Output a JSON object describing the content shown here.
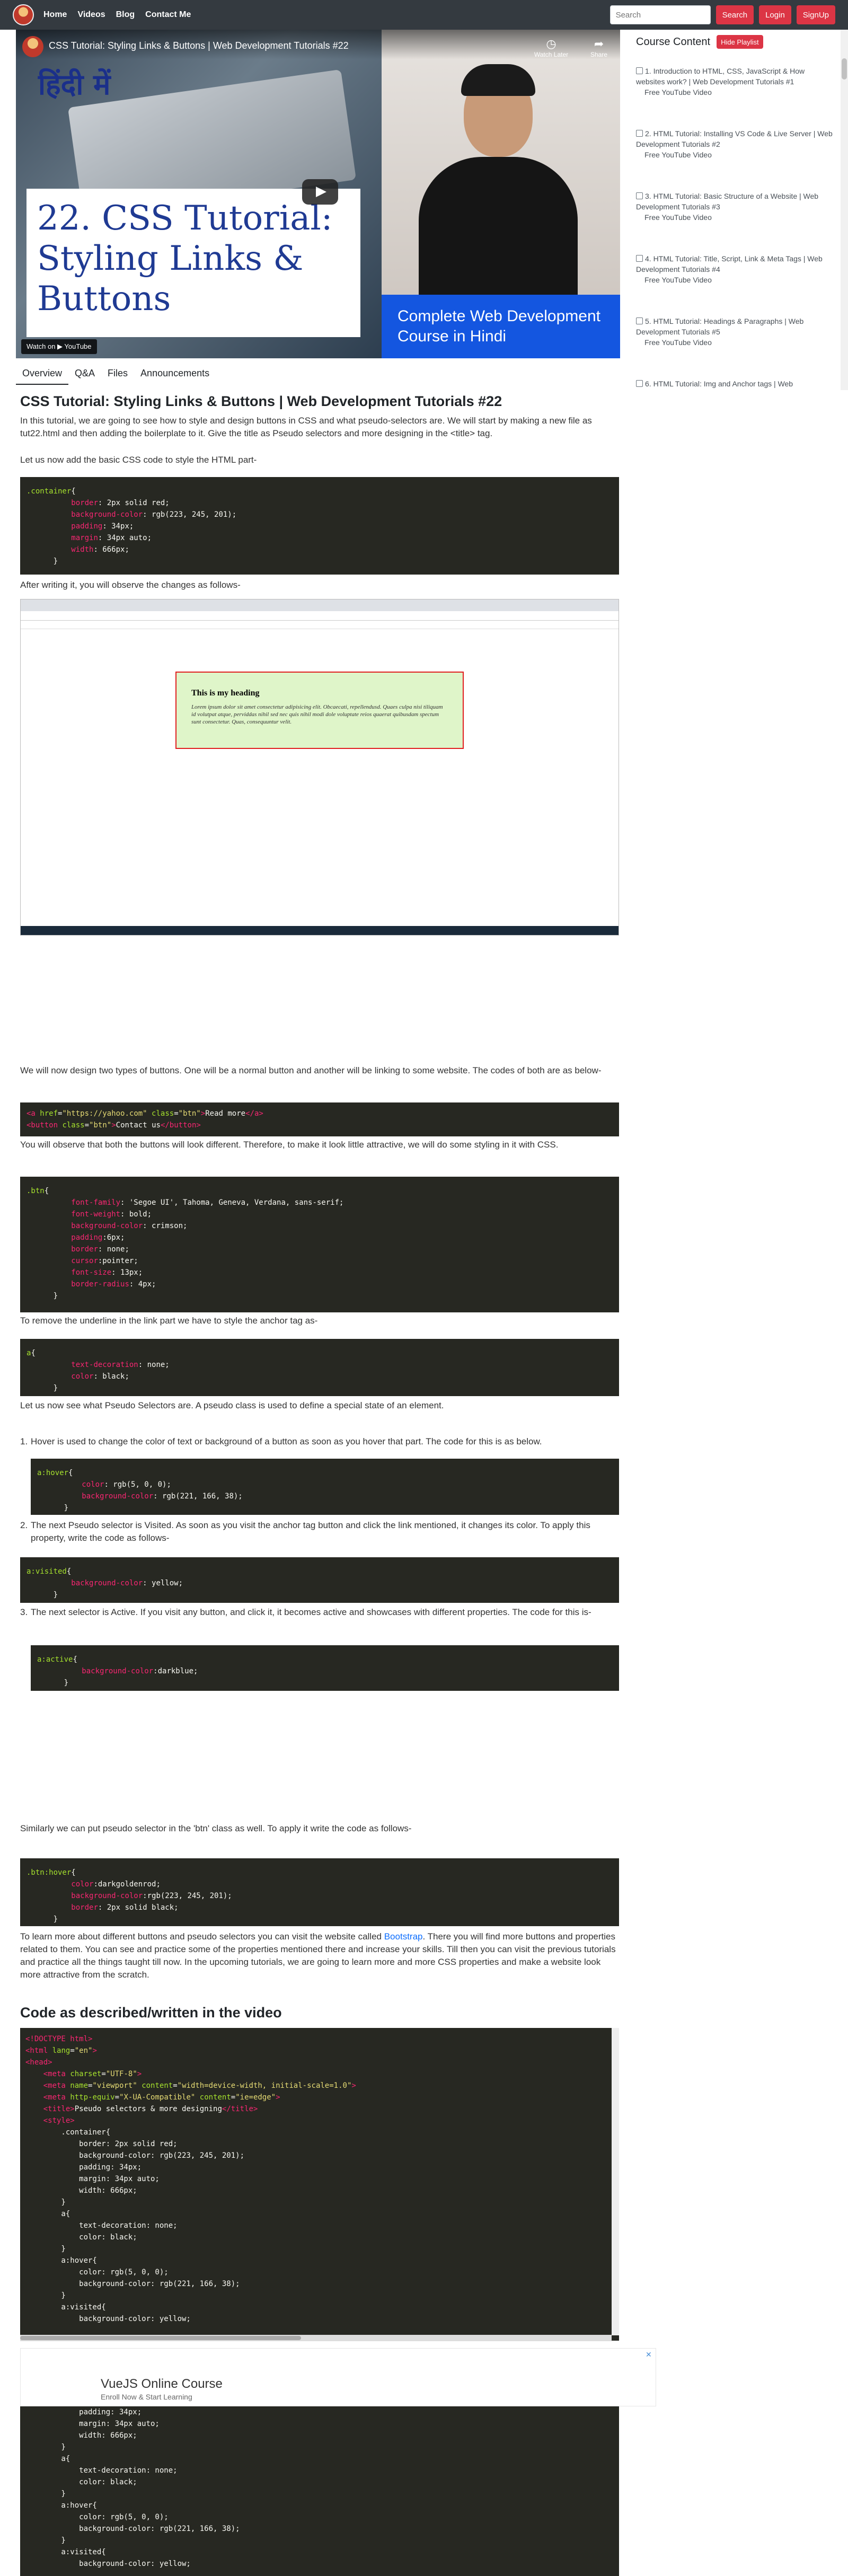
{
  "nav": {
    "links": [
      "Home",
      "Videos",
      "Blog",
      "Contact Me"
    ],
    "search_placeholder": "Search",
    "search_button": "Search",
    "login_button": "Login",
    "signup_button": "SignUp"
  },
  "video": {
    "top_title": "CSS Tutorial: Styling Links & Buttons | Web Development Tutorials #22",
    "hindi_title": "हिंदी में",
    "watch_later": "Watch Later",
    "share": "Share",
    "card_title": "22. CSS Tutorial: Styling Links & Buttons",
    "banner": "Complete Web Development Course in Hindi",
    "watch_on": "Watch on ▶ YouTube"
  },
  "sidebar": {
    "title": "Course Content",
    "hide_button": "Hide Playlist",
    "items": [
      {
        "label": "1. Introduction to HTML, CSS, JavaScript & How websites work? | Web Development Tutorials #1",
        "sub": "Free YouTube Video"
      },
      {
        "label": "2. HTML Tutorial: Installing VS Code & Live Server | Web Development Tutorials #2",
        "sub": "Free YouTube Video"
      },
      {
        "label": "3. HTML Tutorial: Basic Structure of a Website | Web Development Tutorials #3",
        "sub": "Free YouTube Video"
      },
      {
        "label": "4. HTML Tutorial: Title, Script, Link & Meta Tags | Web Development Tutorials #4",
        "sub": "Free YouTube Video"
      },
      {
        "label": "5. HTML Tutorial: Headings & Paragraphs | Web Development Tutorials #5",
        "sub": "Free YouTube Video"
      },
      {
        "label": "6. HTML Tutorial: Img and Anchor tags | Web",
        "sub": ""
      }
    ]
  },
  "tabs": [
    "Overview",
    "Q&A",
    "Files",
    "Announcements"
  ],
  "article": {
    "title": "CSS Tutorial: Styling Links & Buttons | Web Development Tutorials #22",
    "intro": "In this tutorial, we are going to see how to style and design buttons in CSS and what pseudo-selectors are. We will start by making a new file as tut22.html and then adding the boilerplate to it. Give the title as Pseudo selectors and more designing in the <title> tag.",
    "p_add_css": "Let us now add the basic CSS code to style the HTML part-",
    "p_after": "After writing it, you will observe the changes as follows-",
    "p_buttons": "We will now design two types of buttons. One will be a normal button and another will be linking to some website. The codes of both are as below-",
    "p_observe": "You will observe that both the buttons will look different. Therefore, to make it look little attractive, we will do some styling in it with CSS.",
    "p_underline": "To remove the underline in the link part we have to style the anchor tag as-",
    "p_pseudo": "Let us now see what Pseudo Selectors are. A pseudo class is used to define a special state of an element.",
    "li_hover": "Hover is used to change the color of text or background of a button as soon as you hover that part. The code for this is as below.",
    "li_visited": "The next Pseudo selector is Visited. As soon as you visit the anchor tag button and click the link mentioned, it changes its color. To apply this property, write the code as follows-",
    "li_active": "The next selector is Active. If you visit any button, and click it, it becomes active and showcases with different properties. The code for this is-",
    "p_similar": "Similarly we can put pseudo selector in the 'btn' class as well. To apply it write the code as follows-",
    "p_bootstrap_before": "To learn more about different buttons and pseudo selectors you can visit the website called ",
    "p_bootstrap_link": "Bootstrap",
    "p_bootstrap_after": ". There you will find more buttons and properties related to them. You can see and practice some of the properties mentioned there and increase your skills. Till then you can visit the previous tutorials and practice all the things taught till now. In the upcoming tutorials, we are going to learn more and more CSS properties and make a website look more attractive from the scratch.",
    "section_title": "Code as described/written in the video"
  },
  "screenshot": {
    "heading": "This is my heading",
    "body": "Lorem ipsum dolor sit amet consectetur adipisicing elit. Obcaecati, repellendusd. Quaes culpa nisi tiliquam id volutpat atque, perviddas nihil sed nec quis nihil modi dole voluptate reios quaerat quibusdam spectum sunt consectetur. Quas, consequuntur velit."
  },
  "ad": {
    "title": "VueJS Online Course",
    "subtitle": "Enroll Now & Start Learning",
    "close": "✕"
  },
  "colors": {
    "nav_bg": "#343a40",
    "danger": "#dc3545",
    "code_bg": "#272822",
    "link": "#0d6efd",
    "banner_blue": "#1456e0"
  }
}
